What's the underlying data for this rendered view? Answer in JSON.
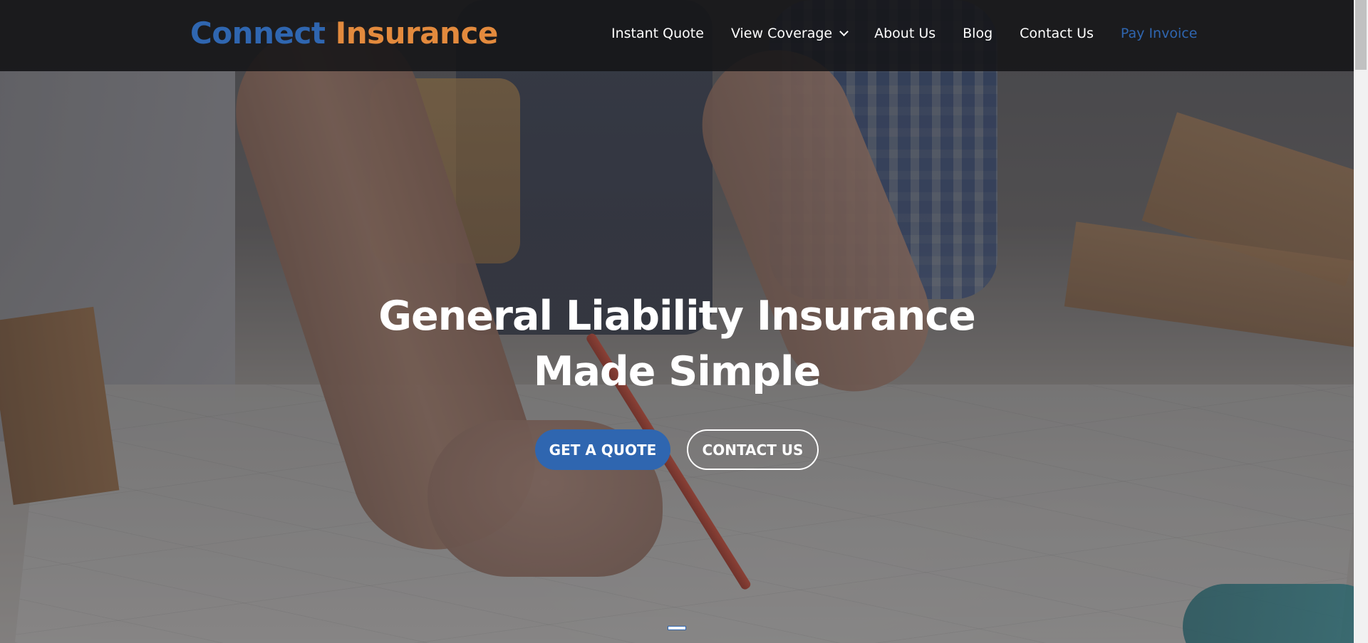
{
  "logo": {
    "part1": "Connect",
    "part2": "Insurance",
    "color_primary": "#2f66b0",
    "color_accent": "#e38a3d"
  },
  "nav": {
    "items": [
      {
        "label": "Instant Quote",
        "dropdown": false,
        "active": false
      },
      {
        "label": "View Coverage",
        "dropdown": true,
        "active": false
      },
      {
        "label": "About Us",
        "dropdown": false,
        "active": false
      },
      {
        "label": "Blog",
        "dropdown": false,
        "active": false
      },
      {
        "label": "Contact Us",
        "dropdown": false,
        "active": false
      },
      {
        "label": "Pay Invoice",
        "dropdown": false,
        "active": true
      }
    ],
    "dropdown_icon": "chevron-down-icon"
  },
  "hero": {
    "title_line1": "General Liability Insurance",
    "title_line2": "Made Simple",
    "primary_button": "GET A QUOTE",
    "secondary_button": "CONTACT US",
    "button_color": "#2f66b0",
    "slide_index": 1
  }
}
